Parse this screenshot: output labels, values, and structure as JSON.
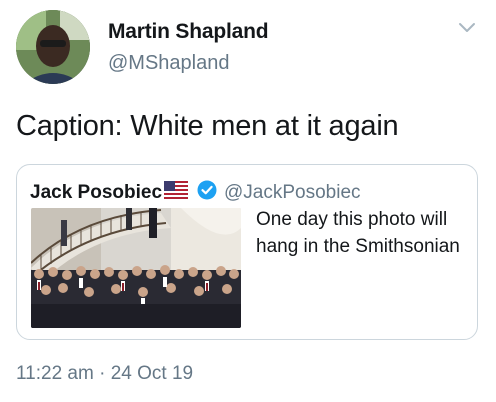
{
  "tweet": {
    "display_name": "Martin Shapland",
    "handle": "@MShapland",
    "text": "Caption: White men at it again",
    "timestamp": "11:22 am · 24 Oct 19"
  },
  "quoted_tweet": {
    "display_name": "Jack Posobiec",
    "handle": "@JackPosobiec",
    "text": "One day this photo will hang in the Smithsonian",
    "flag_icon": "us-flag-icon",
    "verified_icon": "verified-badge-icon"
  },
  "colors": {
    "text_primary": "#14171a",
    "text_secondary": "#657786",
    "border": "#ccd6dd",
    "verified_blue": "#1da1f2"
  },
  "icons": [
    "avatar",
    "chevron-down-icon",
    "us-flag-icon",
    "verified-badge-icon"
  ]
}
